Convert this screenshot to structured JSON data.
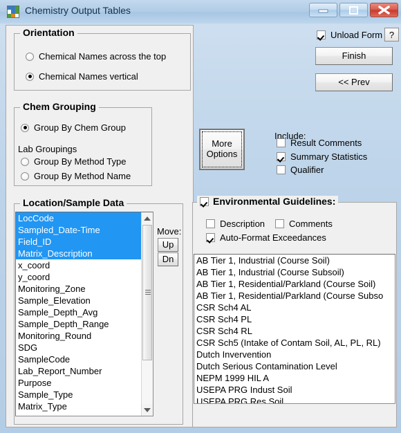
{
  "window": {
    "title": "Chemistry Output Tables",
    "icon": "app-grid-icon",
    "controls": {
      "minimize": "minimize-icon",
      "maximize": "maximize-icon",
      "close": "close-icon"
    },
    "colors": {
      "titlebar": "#b0cce6",
      "close_button": "#d9594a",
      "selection": "#2196f3",
      "panel_face": "#f0f0f0"
    }
  },
  "orientation": {
    "title": "Orientation",
    "options": [
      {
        "label": "Chemical Names across the top",
        "selected": false
      },
      {
        "label": "Chemical Names vertical",
        "selected": true
      }
    ]
  },
  "chem_grouping": {
    "title": "Chem Grouping",
    "primary": {
      "label": "Group By Chem Group",
      "selected": true
    },
    "lab_label": "Lab Groupings",
    "lab_options": [
      {
        "label": "Group By Method Type",
        "selected": false
      },
      {
        "label": "Group By Method Name",
        "selected": false
      }
    ]
  },
  "location_sample": {
    "title": "Location/Sample Data",
    "items": [
      {
        "label": "LocCode",
        "selected": true
      },
      {
        "label": "Sampled_Date-Time",
        "selected": true
      },
      {
        "label": "Field_ID",
        "selected": true
      },
      {
        "label": "Matrix_Description",
        "selected": true
      },
      {
        "label": "x_coord",
        "selected": false
      },
      {
        "label": "y_coord",
        "selected": false
      },
      {
        "label": "Monitoring_Zone",
        "selected": false
      },
      {
        "label": "Sample_Elevation",
        "selected": false
      },
      {
        "label": "Sample_Depth_Avg",
        "selected": false
      },
      {
        "label": "Sample_Depth_Range",
        "selected": false
      },
      {
        "label": "Monitoring_Round",
        "selected": false
      },
      {
        "label": "SDG",
        "selected": false
      },
      {
        "label": "SampleCode",
        "selected": false
      },
      {
        "label": "Lab_Report_Number",
        "selected": false
      },
      {
        "label": "Purpose",
        "selected": false
      },
      {
        "label": "Sample_Type",
        "selected": false
      },
      {
        "label": "Matrix_Type",
        "selected": false
      }
    ],
    "move_label": "Move:",
    "move_up": "Up",
    "move_down": "Dn"
  },
  "more_options": {
    "line1": "More",
    "line2": "Options"
  },
  "include": {
    "title": "Include:",
    "options": [
      {
        "label": "Result Comments",
        "checked": false
      },
      {
        "label": "Summary Statistics",
        "checked": true
      },
      {
        "label": "Qualifier",
        "checked": false
      }
    ]
  },
  "environmental_guidelines": {
    "title": "Environmental Guidelines:",
    "enabled": true,
    "options": [
      {
        "label": "Description",
        "checked": false
      },
      {
        "label": "Comments",
        "checked": false
      },
      {
        "label": "Auto-Format Exceedances",
        "checked": true
      }
    ],
    "items": [
      "AB Tier 1, Industrial (Course Soil)",
      "AB Tier 1, Industrial (Course Subsoil)",
      "AB Tier 1, Residential/Parkland (Course Soil)",
      "AB Tier 1, Residential/Parkland (Course Subso",
      "CSR Sch4 AL",
      "CSR Sch4 PL",
      "CSR Sch4 RL",
      "CSR Sch5 (Intake of Contam Soil, AL, PL, RL)",
      "Dutch Invervention",
      "Dutch Serious Contamination Level",
      "NEPM 1999 HIL A",
      "USEPA PRG Indust Soil",
      "USEPA PRG Res Soil"
    ]
  },
  "actions": {
    "unload_form": {
      "label": "Unload Form",
      "checked": true
    },
    "help": "?",
    "finish": "Finish",
    "prev": "<< Prev"
  }
}
